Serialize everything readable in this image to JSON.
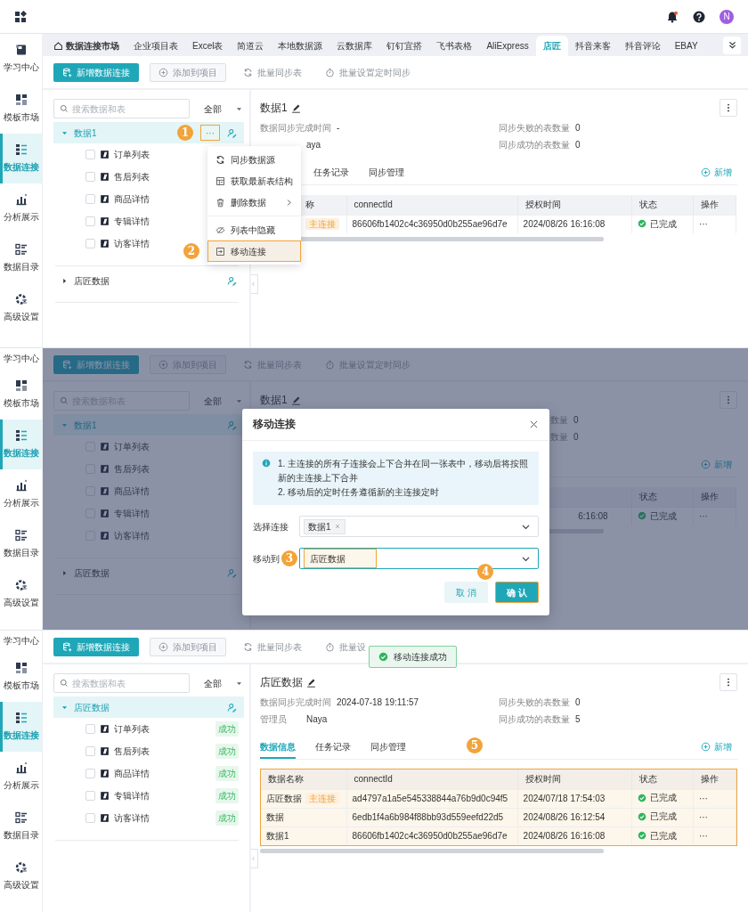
{
  "topbar": {
    "avatar": "N"
  },
  "screens": [
    {
      "kind": "menu-open",
      "sidebar": [
        {
          "label": "学习中心",
          "selected": false,
          "cut": false
        },
        {
          "label": "模板市场",
          "selected": false,
          "cut": false
        },
        {
          "label": "数据连接",
          "selected": true,
          "cut": false
        },
        {
          "label": "分析展示",
          "selected": false,
          "cut": false
        },
        {
          "label": "数据目录",
          "selected": false,
          "cut": false
        },
        {
          "label": "高级设置",
          "selected": false,
          "cut": false
        }
      ],
      "source_tabs": [
        {
          "label": "数据连接市场",
          "kind": "home",
          "selected": false
        },
        {
          "label": "企业项目表",
          "kind": "source",
          "selected": false
        },
        {
          "label": "Excel表",
          "kind": "source",
          "selected": false
        },
        {
          "label": "简道云",
          "kind": "source",
          "selected": false
        },
        {
          "label": "本地数据源",
          "kind": "source",
          "selected": false
        },
        {
          "label": "云数据库",
          "kind": "source",
          "selected": false
        },
        {
          "label": "钉钉宜搭",
          "kind": "source",
          "selected": false
        },
        {
          "label": "飞书表格",
          "kind": "source",
          "selected": false
        },
        {
          "label": "AliExpress",
          "kind": "source",
          "selected": false
        },
        {
          "label": "店匠",
          "kind": "source",
          "selected": true
        },
        {
          "label": "抖音来客",
          "kind": "source",
          "selected": false
        },
        {
          "label": "抖音评论",
          "kind": "source",
          "selected": false
        },
        {
          "label": "EBAY",
          "kind": "source",
          "selected": false
        }
      ],
      "toolbar": [
        {
          "label": "新增数据连接",
          "kind": "primary",
          "disabled": false
        },
        {
          "label": "添加到项目",
          "kind": "outline",
          "disabled": true
        },
        {
          "label": "批量同步表",
          "kind": "text",
          "disabled": true
        },
        {
          "label": "批量设置定时同步",
          "kind": "text",
          "disabled": true
        }
      ],
      "tree": {
        "search_placeholder": "搜索数据和表",
        "filter": "全部",
        "nodes": [
          {
            "label": "数据1",
            "expanded": true,
            "selected": true,
            "actions": "···",
            "annotation": "1",
            "children": [
              {
                "label": "订单列表",
                "checked": false
              },
              {
                "label": "售后列表",
                "checked": false
              },
              {
                "label": "商品详情",
                "checked": false
              },
              {
                "label": "专辑详情",
                "checked": false
              },
              {
                "label": "访客详情",
                "checked": false
              }
            ]
          },
          {
            "label": "店匠数据",
            "expanded": false,
            "selected": false
          }
        ]
      },
      "context_menu": [
        [
          {
            "label": "同步数据源",
            "submenu": false
          },
          {
            "label": "获取最新表结构",
            "submenu": false
          },
          {
            "label": "删除数据",
            "submenu": true
          }
        ],
        [
          {
            "label": "列表中隐藏",
            "submenu": false
          },
          {
            "label": "移动连接",
            "submenu": false,
            "annotation": "2"
          }
        ]
      ],
      "detail": {
        "title": "数据1",
        "stats": {
          "sync_time": {
            "label": "数据同步完成时间",
            "value": "-"
          },
          "failed": {
            "label": "同步失败的表数量",
            "value": "0"
          },
          "admin": {
            "value": "aya"
          },
          "succeeded": {
            "label": "同步成功的表数量",
            "value": "0"
          }
        },
        "tabs": [
          {
            "label": "任务记录",
            "selected": false
          },
          {
            "label": "同步管理",
            "selected": false
          }
        ],
        "add_button": "新增",
        "table": {
          "columns": {
            "name": "称",
            "id": "connectId",
            "time": "授权时间",
            "status": "状态",
            "ops": "操作"
          },
          "rows": [
            {
              "tag": "主连接",
              "id": "86606fb1402c4c36950d0b255ae96d7e",
              "time": "2024/08/26 16:16:08",
              "status": "已完成",
              "ops": "···"
            }
          ]
        }
      }
    },
    {
      "kind": "modal-open",
      "sidebar": [
        {
          "label": "学习中心",
          "selected": false,
          "cut": true
        },
        {
          "label": "模板市场",
          "selected": false,
          "cut": false
        },
        {
          "label": "数据连接",
          "selected": true,
          "cut": false
        },
        {
          "label": "分析展示",
          "selected": false,
          "cut": false
        },
        {
          "label": "数据目录",
          "selected": false,
          "cut": false
        },
        {
          "label": "高级设置",
          "selected": false,
          "cut": false
        }
      ],
      "toolbar": [
        {
          "label": "新增数据连接",
          "kind": "primary",
          "disabled": false
        },
        {
          "label": "添加到项目",
          "kind": "outline",
          "disabled": true
        },
        {
          "label": "批量同步表",
          "kind": "text",
          "disabled": true
        },
        {
          "label": "批量设置定时同步",
          "kind": "text",
          "disabled": true
        }
      ],
      "tree": {
        "search_placeholder": "搜索数据和表",
        "filter": "全部",
        "nodes": [
          {
            "label": "数据1",
            "expanded": true,
            "selected": true,
            "children": [
              {
                "label": "订单列表",
                "checked": false
              },
              {
                "label": "售后列表",
                "checked": false
              },
              {
                "label": "商品详情",
                "checked": false
              },
              {
                "label": "专辑详情",
                "checked": false
              },
              {
                "label": "访客详情",
                "checked": false
              }
            ]
          },
          {
            "label": "店匠数据",
            "expanded": false,
            "selected": false
          }
        ]
      },
      "detail": {
        "title": "数据1",
        "stats": {
          "failed": {
            "label": "数量",
            "value": "0"
          },
          "succeeded": {
            "label": "数量",
            "value": "0"
          }
        },
        "add_button": "新增",
        "table": {
          "columns": {
            "status": "状态",
            "ops": "操作"
          },
          "rows": [
            {
              "time": "6:16:08",
              "status": "已完成",
              "ops": "···"
            }
          ]
        }
      },
      "modal": {
        "title": "移动连接",
        "notes": [
          "1. 主连接的所有子连接会上下合并在同一张表中，移动后将按照新的主连接上下合并",
          "2. 移动后的定时任务遵循新的主连接定时"
        ],
        "fields": [
          {
            "label": "选择连接",
            "tags": [
              "数据1"
            ]
          },
          {
            "label": "移动到",
            "value": "店匠数据",
            "annotation": "3"
          }
        ],
        "buttons": [
          {
            "label": "取 消",
            "kind": "secondary"
          },
          {
            "label": "确 认",
            "kind": "primary",
            "annotation": "4"
          }
        ]
      }
    },
    {
      "kind": "result",
      "sidebar": [
        {
          "label": "学习中心",
          "selected": false,
          "cut": true
        },
        {
          "label": "模板市场",
          "selected": false,
          "cut": false
        },
        {
          "label": "数据连接",
          "selected": true,
          "cut": false
        },
        {
          "label": "分析展示",
          "selected": false,
          "cut": false
        },
        {
          "label": "数据目录",
          "selected": false,
          "cut": false
        },
        {
          "label": "高级设置",
          "selected": false,
          "cut": false
        }
      ],
      "toolbar": [
        {
          "label": "新增数据连接",
          "kind": "primary",
          "disabled": false
        },
        {
          "label": "添加到项目",
          "kind": "outline",
          "disabled": true
        },
        {
          "label": "批量同步表",
          "kind": "text",
          "disabled": true
        },
        {
          "label": "批量设",
          "kind": "text",
          "disabled": true
        }
      ],
      "toast": "移动连接成功",
      "tree": {
        "search_placeholder": "搜索数据和表",
        "filter": "全部",
        "nodes": [
          {
            "label": "店匠数据",
            "expanded": true,
            "selected": true,
            "children": [
              {
                "label": "订单列表",
                "checked": false,
                "badge": "成功"
              },
              {
                "label": "售后列表",
                "checked": false,
                "badge": "成功"
              },
              {
                "label": "商品详情",
                "checked": false,
                "badge": "成功"
              },
              {
                "label": "专辑详情",
                "checked": false,
                "badge": "成功"
              },
              {
                "label": "访客详情",
                "checked": false,
                "badge": "成功"
              }
            ]
          }
        ]
      },
      "detail": {
        "title": "店匠数据",
        "stats": {
          "sync_time": {
            "label": "数据同步完成时间",
            "value": "2024-07-18 19:11:57"
          },
          "failed": {
            "label": "同步失败的表数量",
            "value": "0"
          },
          "admin": {
            "label": "管理员",
            "value": "Naya"
          },
          "succeeded": {
            "label": "同步成功的表数量",
            "value": "5"
          }
        },
        "tabs": [
          {
            "label": "数据信息",
            "selected": true
          },
          {
            "label": "任务记录",
            "selected": false
          },
          {
            "label": "同步管理",
            "selected": false
          }
        ],
        "add_button": "新增",
        "table": {
          "annotation": "5",
          "columns": {
            "name": "数据名称",
            "id": "connectId",
            "time": "授权时间",
            "status": "状态",
            "ops": "操作"
          },
          "rows": [
            {
              "name": "店匠数据",
              "tag": "主连接",
              "id": "ad4797a1a5e545338844a76b9d0c94f5",
              "time": "2024/07/18 17:54:03",
              "status": "已完成",
              "ops": "···"
            },
            {
              "name": "数据",
              "id": "6edb1f4a6b984f88bb93d559eefd22d5",
              "time": "2024/08/26 16:12:54",
              "status": "已完成",
              "ops": "···"
            },
            {
              "name": "数据1",
              "id": "86606fb1402c4c36950d0b255ae96d7e",
              "time": "2024/08/26 16:16:08",
              "status": "已完成",
              "ops": "···"
            }
          ]
        }
      }
    }
  ]
}
